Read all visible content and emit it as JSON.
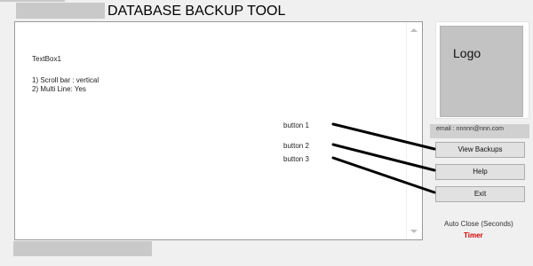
{
  "window": {
    "title": "DATABASE BACKUP TOOL"
  },
  "textbox": {
    "name": "TextBox1",
    "line1": "1) Scroll bar : vertical",
    "line2": "2) Multi Line: Yes"
  },
  "annotations": {
    "button1": "button 1",
    "button2": "button 2",
    "button3": "button 3"
  },
  "logo": {
    "label": "Logo"
  },
  "contact": {
    "email": "email : nnnnn@nnn.com"
  },
  "buttons": {
    "view_backups": "View Backups",
    "help": "Help",
    "exit": "Exit"
  },
  "auto_close": {
    "label": "Auto Close (Seconds)",
    "timer": "Timer",
    "timer_color": "#d40000"
  },
  "colors": {
    "background": "#f0f0f0",
    "placeholder_gray": "#c9c9c9"
  }
}
